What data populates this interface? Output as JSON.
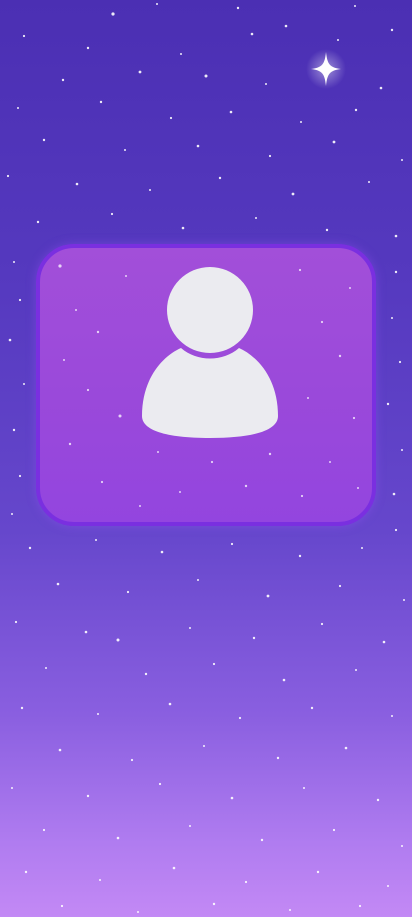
{
  "screen": {
    "name": "profile-avatar-screen",
    "background_top_color": "#4b2fb3",
    "background_bottom_color": "#c389f5"
  },
  "decorations": {
    "sparkle_icon": "four-point-star",
    "sparkle_color": "#ffffff"
  },
  "profile": {
    "avatar_icon": "user-icon",
    "avatar_color": "#ebebf0",
    "card_fill_color": "#9a49da",
    "card_border_color": "#7a2fe0"
  }
}
